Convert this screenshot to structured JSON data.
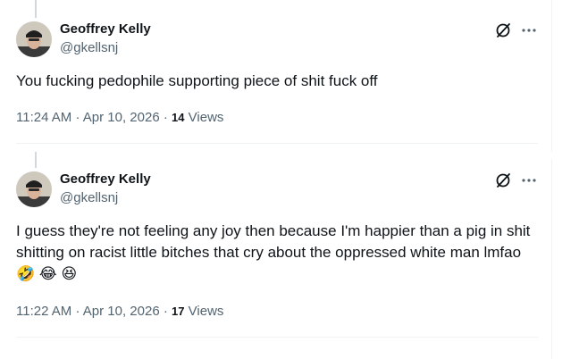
{
  "posts": [
    {
      "author_name": "Geoffrey Kelly",
      "author_handle": "@gkellsnj",
      "text": "You fucking pedophile supporting piece of shit fuck off",
      "time": "11:24 AM",
      "date": "Apr 10, 2026",
      "views_count": "14",
      "views_label": "Views"
    },
    {
      "author_name": "Geoffrey Kelly",
      "author_handle": "@gkellsnj",
      "text": "I guess they're not feeling any joy then because I'm happier than a pig in shit shitting on racist little bitches that cry about the oppressed white man lmfao 🤣 😂 😆",
      "time": "11:22 AM",
      "date": "Apr 10, 2026",
      "views_count": "17",
      "views_label": "Views"
    }
  ],
  "icons": {
    "grok": "grok-icon",
    "more": "more-icon"
  },
  "colors": {
    "text_primary": "#0f1419",
    "text_secondary": "#536471",
    "divider": "#eff3f4"
  }
}
